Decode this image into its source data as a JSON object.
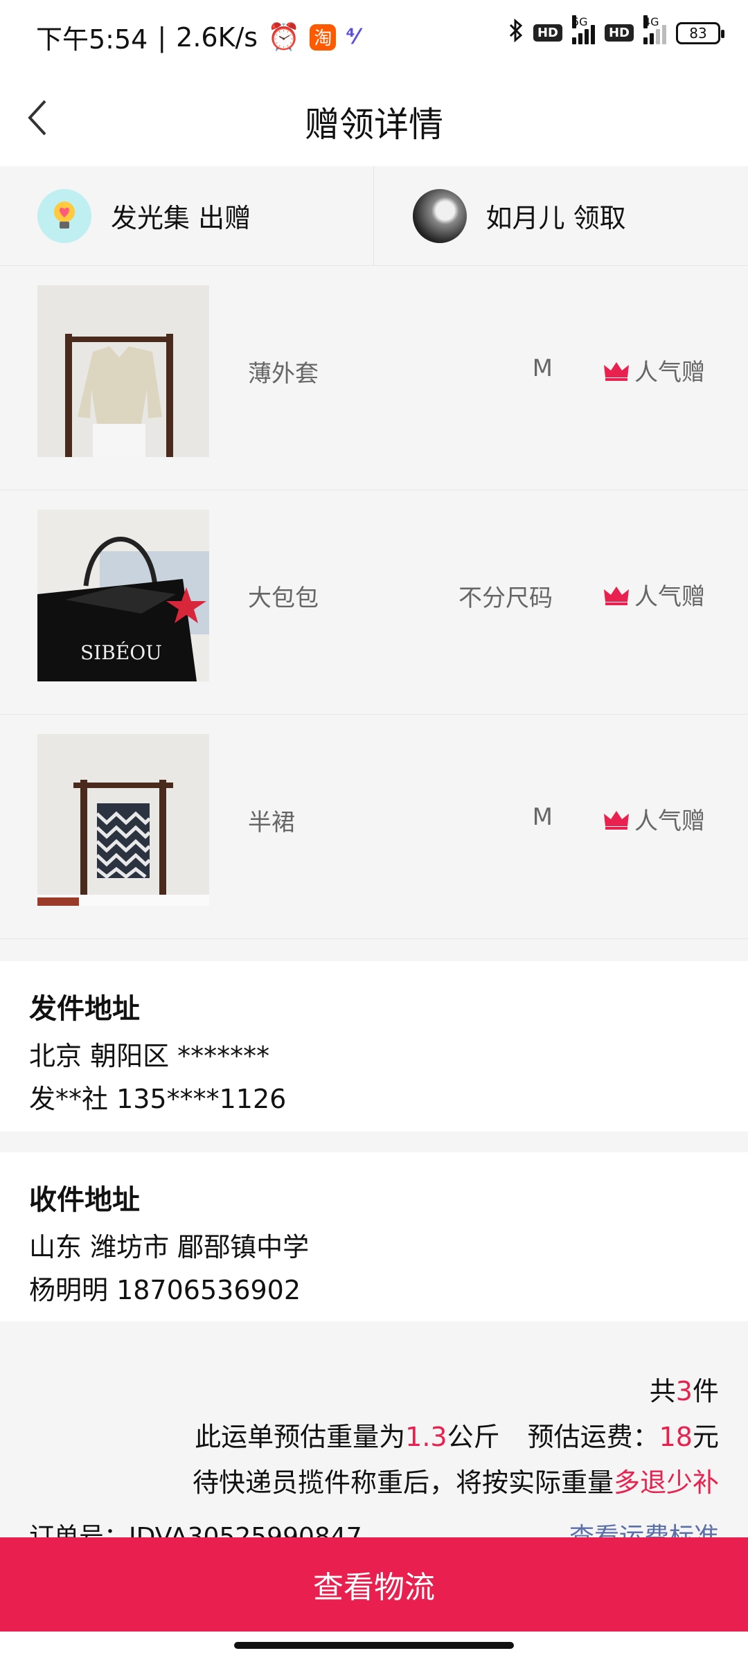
{
  "status_bar": {
    "time": "下午5:54",
    "speed": "2.6K/s",
    "alarm_icon": "alarm-icon",
    "taobao_badge": "淘",
    "app_badge": "⁴⁄",
    "hd_1": "HD",
    "net_1": "5G",
    "hd_2": "HD",
    "net_2": "4G",
    "battery": "83"
  },
  "header": {
    "title": "赠领详情",
    "back_icon": "chevron-left-icon"
  },
  "parties": {
    "giver": {
      "name": "发光集 出赠",
      "avatar_icon": "lightbulb-heart-icon"
    },
    "receiver": {
      "name": "如月儿 领取",
      "avatar_icon": "user-avatar"
    }
  },
  "items": [
    {
      "name": "薄外套",
      "size": "M",
      "tag": "人气赠",
      "image": "jacket-photo"
    },
    {
      "name": "大包包",
      "size": "不分尺码",
      "tag": "人气赠",
      "image": "bag-photo"
    },
    {
      "name": "半裙",
      "size": "M",
      "tag": "人气赠",
      "image": "skirt-photo"
    }
  ],
  "sender": {
    "title": "发件地址",
    "line1": "北京 朝阳区 *******",
    "line2": "发**社 135****1126"
  },
  "receiver_address": {
    "title": "收件地址",
    "line1": "山东 潍坊市 郿郚镇中学",
    "line2": "杨明明 18706536902"
  },
  "summary": {
    "count_prefix": "共",
    "count": "3",
    "count_suffix": "件",
    "weight_prefix": "此运单预估重量为",
    "weight": "1.3",
    "weight_unit": "公斤",
    "fee_prefix": "预估运费：",
    "fee": "18",
    "fee_unit": "元",
    "note_prefix": "待快递员揽件称重后，将按实际重量",
    "note_highlight": "多退少补",
    "order_label": "订单号：JDVA30525990847",
    "order_link": "查看运费标准"
  },
  "actions": {
    "view_logistics": "查看物流"
  },
  "colors": {
    "accent": "#e81f4f",
    "tag_crown": "#e8214f",
    "background": "#f5f5f5"
  }
}
